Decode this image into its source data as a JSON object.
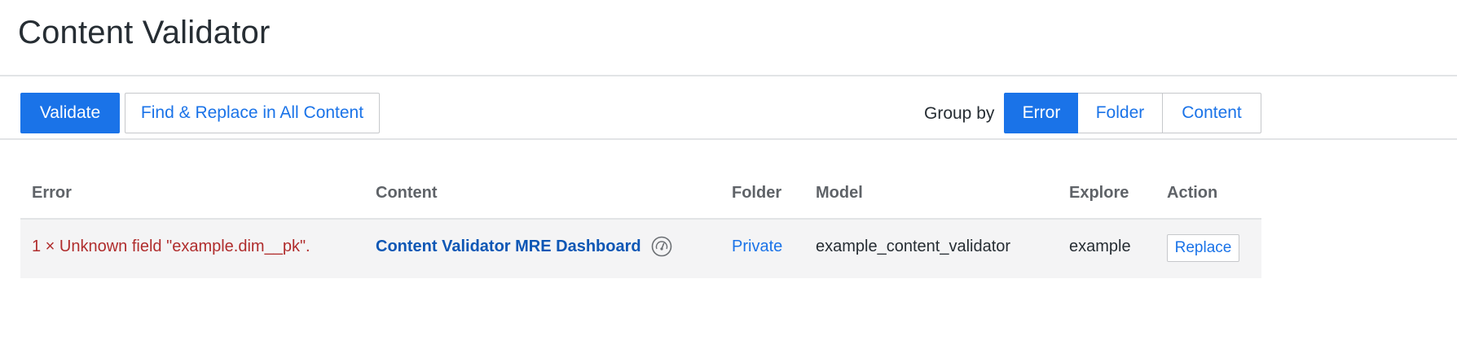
{
  "header": {
    "title": "Content Validator"
  },
  "toolbar": {
    "validate_label": "Validate",
    "find_replace_label": "Find & Replace in All Content",
    "group_by_label": "Group by",
    "group_options": [
      "Error",
      "Folder",
      "Content"
    ],
    "group_selected": "Error"
  },
  "table": {
    "columns": [
      "Error",
      "Content",
      "Folder",
      "Model",
      "Explore",
      "Action"
    ],
    "rows": [
      {
        "error": "1 × Unknown field \"example.dim__pk\".",
        "content": "Content Validator MRE Dashboard",
        "content_icon": "dashboard-gauge-icon",
        "folder": "Private",
        "model": "example_content_validator",
        "explore": "example",
        "action": "Replace"
      }
    ]
  },
  "colors": {
    "accent": "#1a73e8",
    "error_text": "#b02d2d",
    "row_bg": "#f4f4f5"
  }
}
